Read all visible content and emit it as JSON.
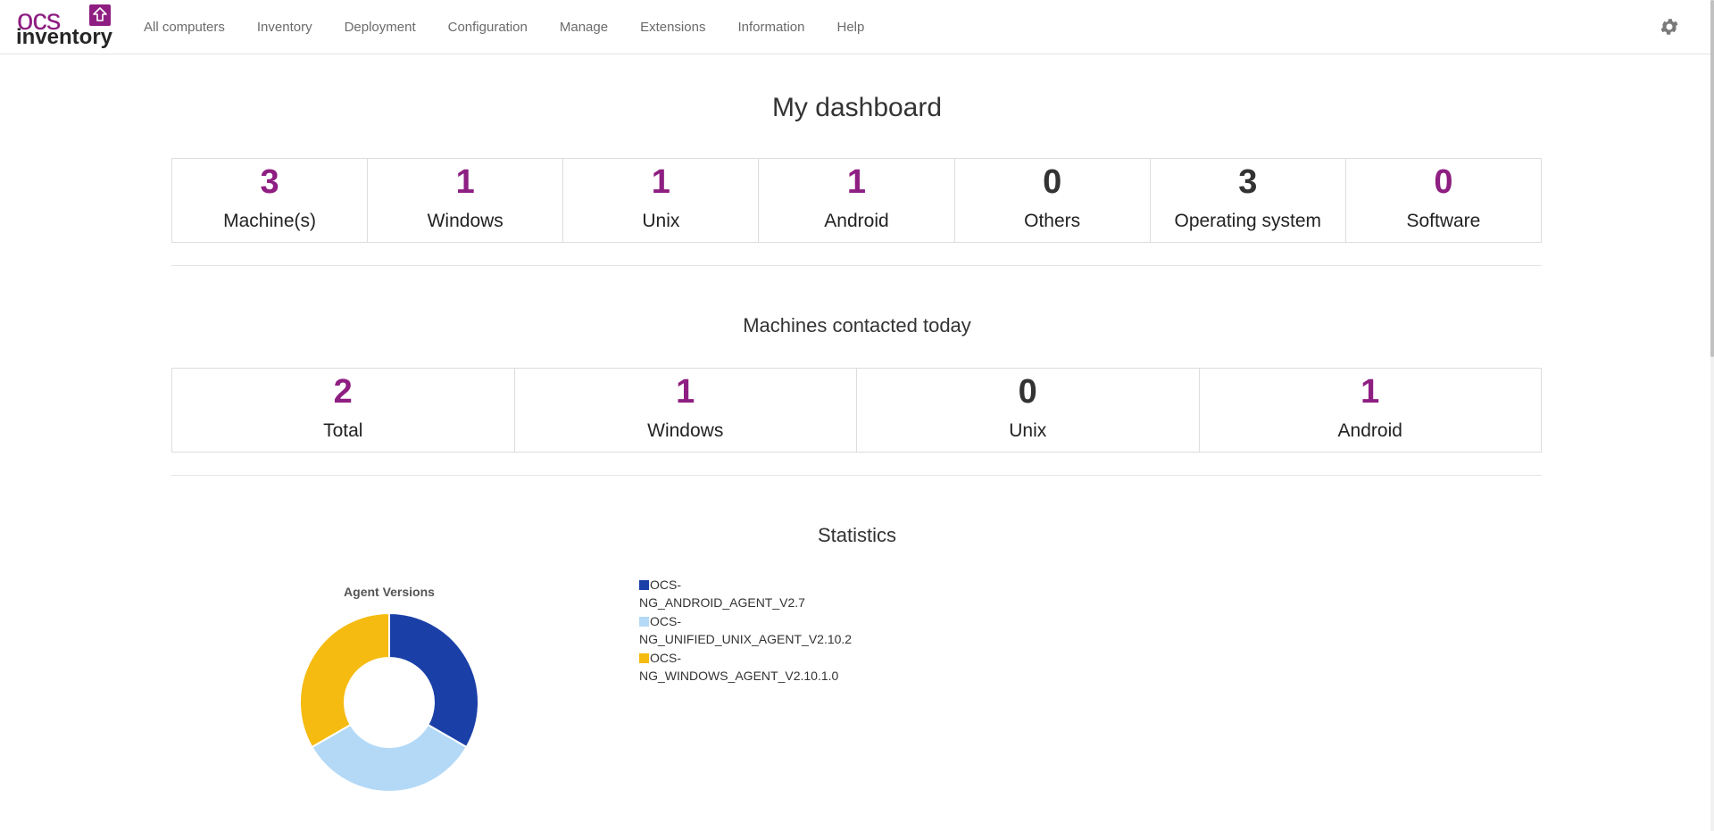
{
  "app": {
    "logo_text_top": "ocs",
    "logo_text_bottom": "inventory",
    "brand_color": "#8e1e82"
  },
  "nav": {
    "items": [
      {
        "label": "All computers"
      },
      {
        "label": "Inventory"
      },
      {
        "label": "Deployment"
      },
      {
        "label": "Configuration"
      },
      {
        "label": "Manage"
      },
      {
        "label": "Extensions"
      },
      {
        "label": "Information"
      },
      {
        "label": "Help"
      }
    ],
    "settings_icon": "gear-icon"
  },
  "dashboard": {
    "title": "My dashboard",
    "stats": [
      {
        "value": "3",
        "label": "Machine(s)",
        "color": "purple"
      },
      {
        "value": "1",
        "label": "Windows",
        "color": "purple"
      },
      {
        "value": "1",
        "label": "Unix",
        "color": "purple"
      },
      {
        "value": "1",
        "label": "Android",
        "color": "purple"
      },
      {
        "value": "0",
        "label": "Others",
        "color": "dark"
      },
      {
        "value": "3",
        "label": "Operating system",
        "color": "dark"
      },
      {
        "value": "0",
        "label": "Software",
        "color": "purple"
      }
    ]
  },
  "contacted": {
    "title": "Machines contacted today",
    "stats": [
      {
        "value": "2",
        "label": "Total",
        "color": "purple"
      },
      {
        "value": "1",
        "label": "Windows",
        "color": "purple"
      },
      {
        "value": "0",
        "label": "Unix",
        "color": "dark"
      },
      {
        "value": "1",
        "label": "Android",
        "color": "purple"
      }
    ]
  },
  "statistics": {
    "title": "Statistics"
  },
  "chart_data": {
    "type": "pie",
    "title": "Agent Versions",
    "donut": true,
    "legend_position": "right",
    "slices": [
      {
        "label_line1": "OCS-",
        "label_line2": "NG_ANDROID_AGENT_V2.7",
        "value": 1,
        "color": "#1a40a8"
      },
      {
        "label_line1": "OCS-",
        "label_line2": "NG_UNIFIED_UNIX_AGENT_V2.10.2",
        "value": 1,
        "color": "#b3d9f7"
      },
      {
        "label_line1": "OCS-",
        "label_line2": "NG_WINDOWS_AGENT_V2.10.1.0",
        "value": 1,
        "color": "#f5bb10"
      }
    ]
  }
}
